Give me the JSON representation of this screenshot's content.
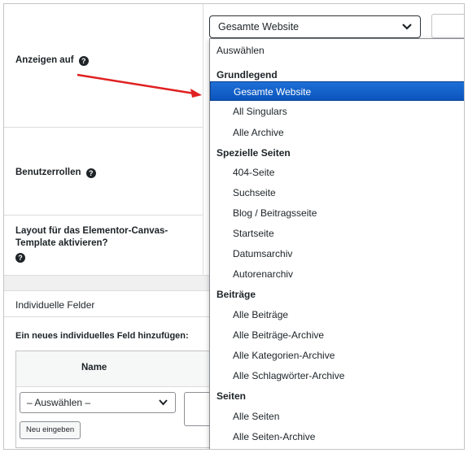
{
  "settings": {
    "display_on_label": "Anzeigen auf",
    "user_roles_label": "Benutzerrollen",
    "canvas_layout_label_line1": "Layout für das Elementor-Canvas-",
    "canvas_layout_label_line2": "Template aktivieren?",
    "help_glyph": "?"
  },
  "display_select": {
    "value": "Gesamte Website",
    "chevron": "⌄"
  },
  "dropdown": {
    "placeholder": "Auswählen",
    "groups": [
      {
        "label": "Grundlegend",
        "options": [
          "Gesamte Website",
          "All Singulars",
          "Alle Archive"
        ]
      },
      {
        "label": "Spezielle Seiten",
        "options": [
          "404-Seite",
          "Suchseite",
          "Blog / Beitragsseite",
          "Startseite",
          "Datumsarchiv",
          "Autorenarchiv"
        ]
      },
      {
        "label": "Beiträge",
        "options": [
          "Alle Beiträge",
          "Alle Beiträge-Archive",
          "Alle Kategorien-Archive",
          "Alle Schlagwörter-Archive"
        ]
      },
      {
        "label": "Seiten",
        "options": [
          "Alle Seiten",
          "Alle Seiten-Archive"
        ]
      }
    ],
    "selected": "Gesamte Website"
  },
  "custom_fields": {
    "section_title": "Individuelle Felder",
    "add_label": "Ein neues individuelles Feld hinzufügen:",
    "name_header": "Name",
    "select_value": "– Auswählen –",
    "new_button": "Neu eingeben"
  },
  "colors": {
    "selected_bg": "#1e6fd6",
    "arrow": "#e02020"
  }
}
